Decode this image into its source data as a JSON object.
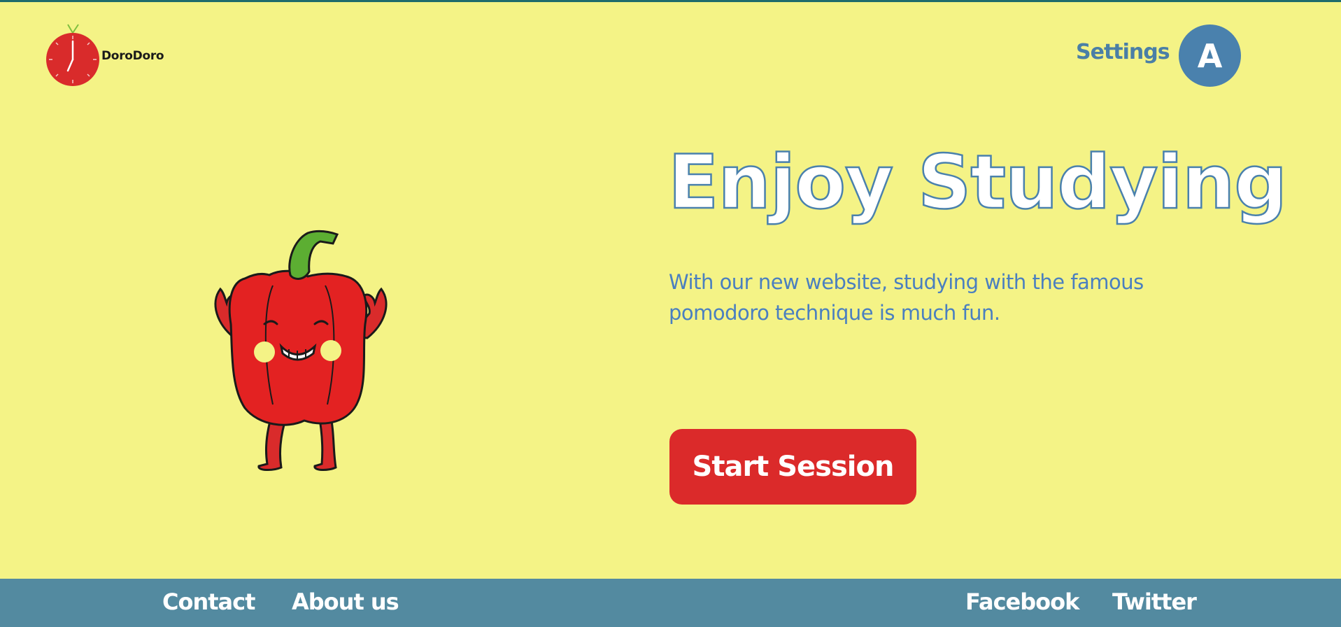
{
  "header": {
    "brand": "DoroDoro",
    "settings_label": "Settings",
    "avatar_initial": "A"
  },
  "hero": {
    "title": "Enjoy Studying",
    "description": "With our new website, studying with the famous pomodoro technique is much fun.",
    "cta_label": "Start Session"
  },
  "footer": {
    "links_left": [
      "Contact",
      "About us"
    ],
    "links_right": [
      "Facebook",
      "Twitter"
    ]
  },
  "colors": {
    "background": "#f4f386",
    "accent_red": "#db2a2a",
    "accent_blue": "#4a81ad",
    "footer": "#538aa0"
  },
  "icons": {
    "logo": "tomato-clock-icon",
    "hero_illustration": "bell-pepper-mascot"
  }
}
